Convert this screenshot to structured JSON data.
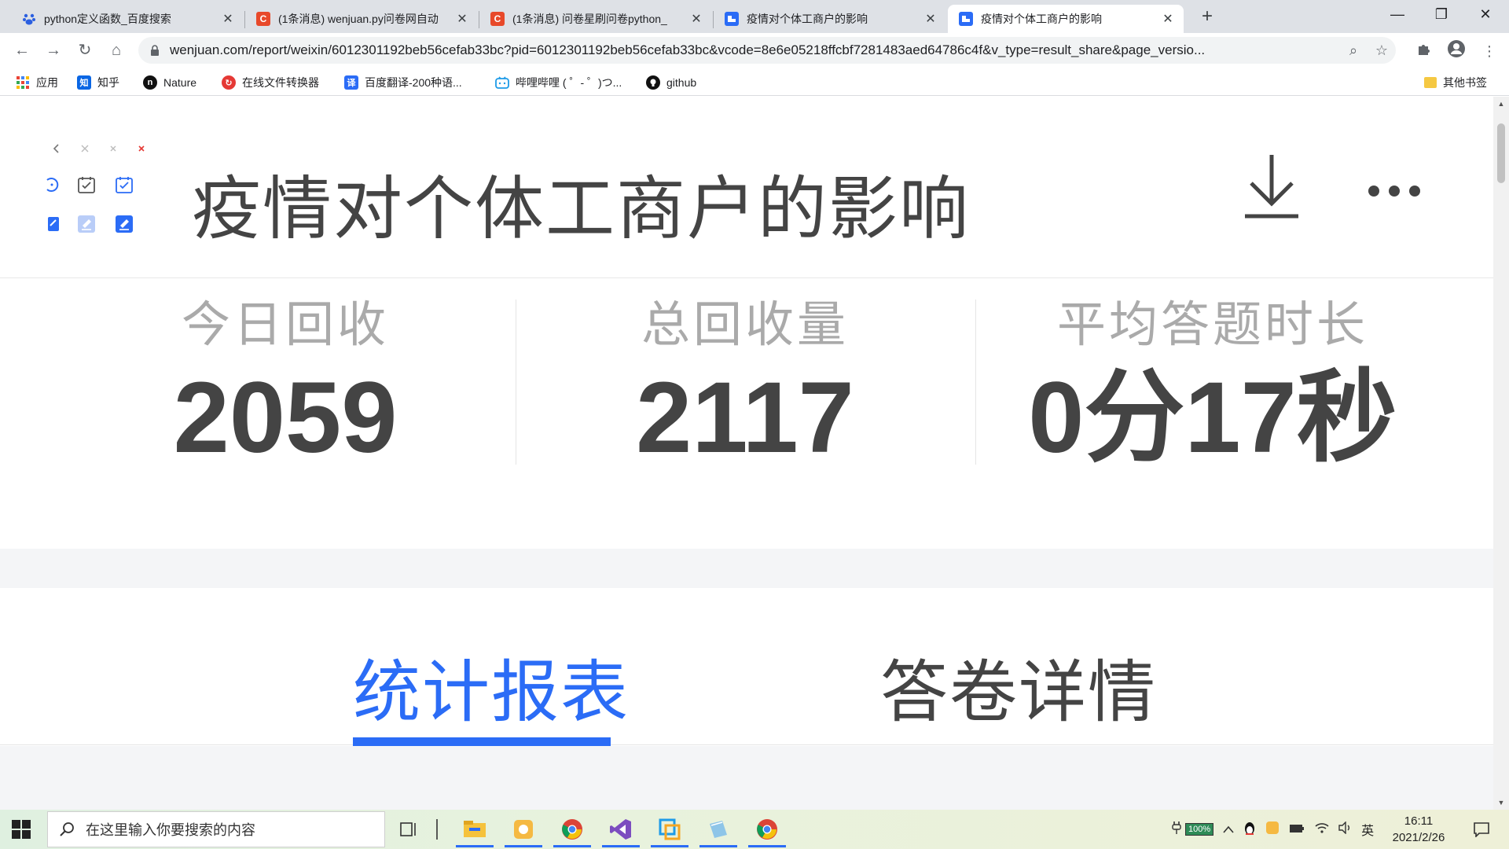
{
  "browser": {
    "tabs": [
      {
        "title": "python定义函数_百度搜索",
        "icon": "baidu-paw-icon",
        "color": "#2b5fe0"
      },
      {
        "title": "(1条消息) wenjuan.py问卷网自动",
        "icon": "csdn-c-icon",
        "color": "#e8492a"
      },
      {
        "title": "(1条消息) 问卷星刷问卷python_",
        "icon": "csdn-c-icon",
        "color": "#e8492a"
      },
      {
        "title": "疫情对个体工商户的影响",
        "icon": "wenjuan-icon",
        "color": "#2b6cf6"
      },
      {
        "title": "疫情对个体工商户的影响",
        "icon": "wenjuan-icon",
        "color": "#2b6cf6"
      }
    ],
    "new_tab": "+",
    "window_controls": {
      "minimize": "—",
      "restore": "❐",
      "close": "✕"
    },
    "url": "wenjuan.com/report/weixin/6012301192beb56cefab33bc?pid=6012301192beb56cefab33bc&vcode=8e6e05218ffcbf7281483aed64786c4f&v_type=result_share&page_versio...",
    "bookmarks": [
      {
        "label": "应用",
        "icon": "apps-grid-icon"
      },
      {
        "label": "知乎",
        "icon": "zhihu-icon"
      },
      {
        "label": "Nature",
        "icon": "nature-icon"
      },
      {
        "label": "在线文件转换器",
        "icon": "converter-icon"
      },
      {
        "label": "百度翻译-200种语...",
        "icon": "baidu-translate-icon"
      },
      {
        "label": "哔哩哔哩 ( ゜- ゜)つ...",
        "icon": "bilibili-icon"
      },
      {
        "label": "github",
        "icon": "github-icon"
      }
    ],
    "other_bookmarks": "其他书签"
  },
  "page": {
    "title": "疫情对个体工商户的影响",
    "stats": [
      {
        "label": "今日回收",
        "value": "2059"
      },
      {
        "label": "总回收量",
        "value": "2117"
      },
      {
        "label": "平均答题时长",
        "value": "0分17秒"
      }
    ],
    "tabs": [
      {
        "label": "统计报表",
        "active": true
      },
      {
        "label": "答卷详情",
        "active": false
      }
    ],
    "accent_color": "#2b6cf6"
  },
  "taskbar": {
    "search_placeholder": "在这里输入你要搜索的内容",
    "battery": "100%",
    "ime": "英",
    "time": "16:11",
    "date": "2021/2/26"
  }
}
